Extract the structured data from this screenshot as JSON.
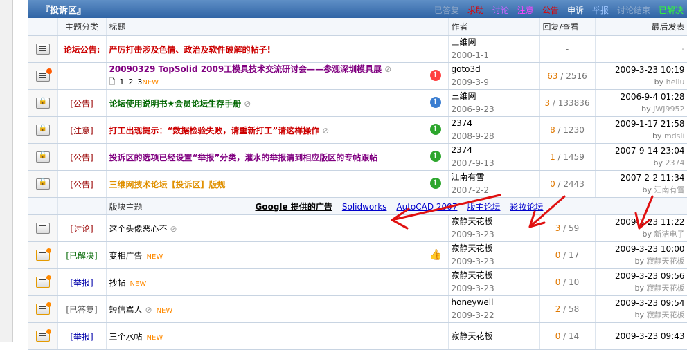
{
  "header": {
    "board_title": "『投诉区』",
    "tabs": [
      "已答复",
      "求助",
      "讨论",
      "注意",
      "公告",
      "申诉",
      "举报",
      "讨论结束",
      "已解决"
    ]
  },
  "columns": {
    "category": "主题分类",
    "title": "标题",
    "author": "作者",
    "counts": "回复/查看",
    "last": "最后发表"
  },
  "pinned": [
    {
      "icon": "notice-icon",
      "category": "论坛公告:",
      "cat_style": "t-red",
      "title": "严厉打击涉及色情、政治及软件破解的帖子!",
      "title_style": "t-red",
      "author": "三维网",
      "date": "2000-1-1",
      "replies": "",
      "views": "-",
      "last_time": "",
      "last_by": "-"
    },
    {
      "icon": "hot-topic-icon",
      "category": "",
      "title": "20090329 TopSolid 2009工模具技术交流研讨会——参观深圳模具展",
      "title_style": "t-purple",
      "attachment": true,
      "pages": [
        "1",
        "2",
        "3"
      ],
      "new_label": "NEW",
      "rank": "3",
      "author": "goto3d",
      "date": "2009-3-9",
      "replies": "63",
      "views": "2516",
      "last_time": "2009-3-23 10:19",
      "last_by_prefix": "by",
      "last_by": "heilu"
    },
    {
      "icon": "lock-icon",
      "category": "[公告]",
      "title": "论坛使用说明书★会员论坛生存手册",
      "title_style": "t-green",
      "attachment": true,
      "rank": "2",
      "author": "三维网",
      "date": "2006-9-23",
      "replies": "3",
      "views": "133836",
      "last_time": "2006-9-4 01:28",
      "last_by_prefix": "by",
      "last_by": "JWJ9952"
    },
    {
      "icon": "lock-icon",
      "category": "[注意]",
      "title": "打工出现提示：“数据检验失败，请重新打工”请这样操作",
      "title_style": "t-red",
      "attachment": true,
      "rank": "1",
      "author": "2374",
      "date": "2008-9-28",
      "replies": "8",
      "views": "1230",
      "last_time": "2009-1-17 21:58",
      "last_by_prefix": "by",
      "last_by": "mdsli"
    },
    {
      "icon": "lock-icon",
      "category": "[公告]",
      "title": "投诉区的选项已经设置“举报”分类，灌水的举报请到相应版区的专帖跟帖",
      "title_style": "t-purple",
      "rank": "1",
      "author": "2374",
      "date": "2007-9-13",
      "replies": "1",
      "views": "1459",
      "last_time": "2007-9-14 23:04",
      "last_by_prefix": "by",
      "last_by": "2374"
    },
    {
      "icon": "lock-icon",
      "category": "[公告]",
      "title": "三维网技术论坛【投诉区】版规",
      "title_style": "t-orange",
      "rank": "1",
      "author": "江南有雪",
      "date": "2007-2-2",
      "replies": "0",
      "views": "2443",
      "last_time": "2007-2-2 11:34",
      "last_by_prefix": "by",
      "last_by": "江南有雪"
    }
  ],
  "separator": {
    "label": "版块主题",
    "ads": [
      "Google 提供的广告",
      "Solidworks",
      "AutoCAD 2007",
      "版主论坛",
      "彩妆论坛"
    ]
  },
  "threads": [
    {
      "icon": "topic-icon",
      "category": "[讨论]",
      "cat_style": "cat-c1",
      "title": "这个头像恶心不",
      "attachment": true,
      "author": "寂静天花板",
      "date": "2009-3-23",
      "replies": "3",
      "views": "59",
      "last_time": "2009-3-23 11:22",
      "last_by_prefix": "by",
      "last_by": "新洁电子"
    },
    {
      "icon": "new-topic-icon",
      "category": "[已解决]",
      "cat_style": "cat-c3",
      "title": "变相广告",
      "new_label": "NEW",
      "thumb": true,
      "author": "寂静天花板",
      "date": "2009-3-23",
      "replies": "0",
      "views": "17",
      "last_time": "2009-3-23 10:00",
      "last_by_prefix": "by",
      "last_by": "寂静天花板"
    },
    {
      "icon": "new-topic-icon",
      "category": "[举报]",
      "cat_style": "cat-c4",
      "title": "抄帖",
      "new_label": "NEW",
      "author": "寂静天花板",
      "date": "2009-3-23",
      "replies": "0",
      "views": "10",
      "last_time": "2009-3-23 09:56",
      "last_by_prefix": "by",
      "last_by": "寂静天花板"
    },
    {
      "icon": "new-topic-icon",
      "category": "[已答复]",
      "cat_style": "cat-c5",
      "title": "短信骂人",
      "attachment": true,
      "new_label": "NEW",
      "author": "honeywell",
      "date": "2009-3-22",
      "replies": "2",
      "views": "58",
      "last_time": "2009-3-23 09:54",
      "last_by_prefix": "by",
      "last_by": "寂静天花板"
    },
    {
      "icon": "new-topic-icon",
      "category": "[举报]",
      "cat_style": "cat-c4",
      "title": "三个水帖",
      "new_label": "NEW",
      "author": "寂静天花板",
      "date": "",
      "replies": "0",
      "views": "14",
      "last_time": "2009-3-23 09:43",
      "last_by_prefix": "",
      "last_by": ""
    }
  ],
  "colors": {
    "header_bg": "#3a6fb0",
    "arrow": "#e01010",
    "reply_count": "#e07800"
  }
}
